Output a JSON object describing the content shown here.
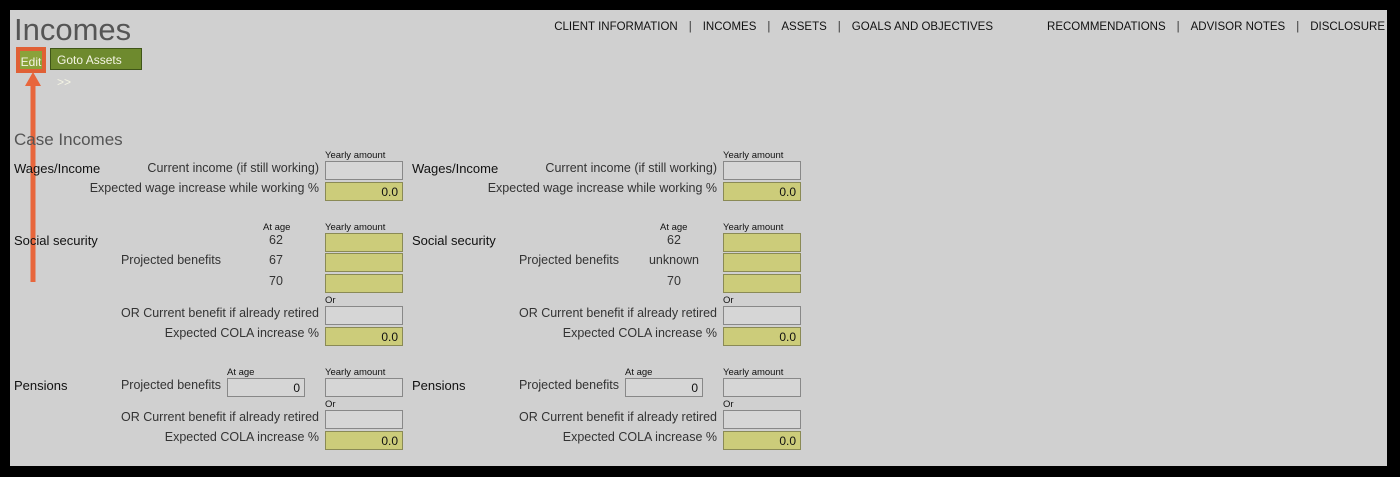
{
  "page": {
    "title": "Incomes"
  },
  "nav": {
    "items": [
      {
        "label": "CLIENT INFORMATION"
      },
      {
        "label": "INCOMES"
      },
      {
        "label": "ASSETS"
      },
      {
        "label": "GOALS AND OBJECTIVES"
      },
      {
        "label": "RECOMMENDATIONS"
      },
      {
        "label": "ADVISOR NOTES"
      },
      {
        "label": "DISCLOSURE"
      }
    ],
    "separator": "|"
  },
  "toolbar": {
    "edit_label": "Edit",
    "goto_label": "Goto Assets >>"
  },
  "section_title": "Case Incomes",
  "labels": {
    "wages": "Wages/Income",
    "current_income": "Current income (if still working)",
    "wage_increase": "Expected wage increase while working %",
    "social_security": "Social security",
    "projected_benefits": "Projected benefits",
    "or_current_benefit": "OR Current benefit if already retired",
    "cola": "Expected COLA increase %",
    "pensions": "Pensions",
    "yearly_amount": "Yearly amount",
    "at_age": "At age",
    "or": "Or"
  },
  "columns": [
    {
      "wage_increase": "0.0",
      "ss_ages": [
        "62",
        "67",
        "70"
      ],
      "ss_cola": "0.0",
      "pension_age": "0",
      "pension_cola": "0.0"
    },
    {
      "wage_increase": "0.0",
      "ss_ages": [
        "62",
        "unknown",
        "70"
      ],
      "ss_cola": "0.0",
      "pension_age": "0",
      "pension_cola": "0.0"
    }
  ],
  "colors": {
    "accent_green": "#8aa23a",
    "highlight": "#e06035",
    "field_yellow": "#cccc7a"
  }
}
